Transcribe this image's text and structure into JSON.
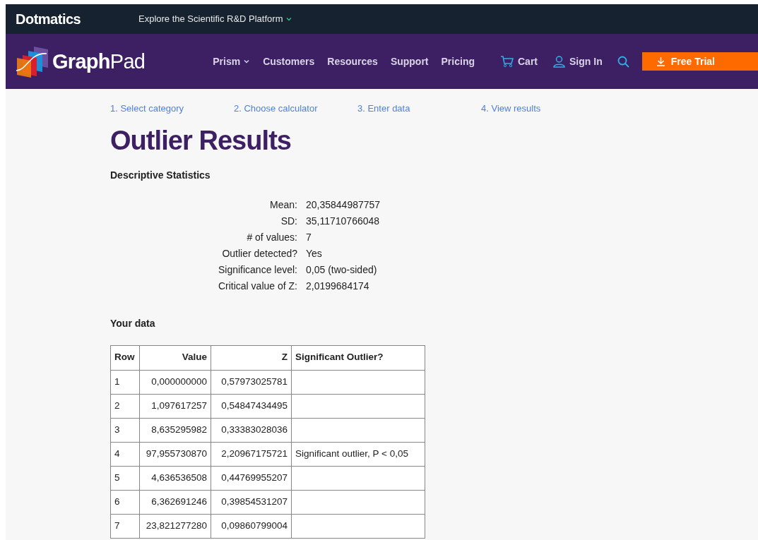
{
  "top_bar": {
    "brand": "Dotmatics",
    "explore": "Explore the Scientific R&D Platform"
  },
  "nav": {
    "logo_bold": "Graph",
    "logo_light": "Pad",
    "items": [
      {
        "label": "Prism",
        "dropdown": true
      },
      {
        "label": "Customers",
        "dropdown": false
      },
      {
        "label": "Resources",
        "dropdown": false
      },
      {
        "label": "Support",
        "dropdown": false
      },
      {
        "label": "Pricing",
        "dropdown": false
      }
    ],
    "cart": "Cart",
    "sign_in": "Sign In",
    "cta": "Free Trial"
  },
  "steps": [
    "1. Select category",
    "2. Choose calculator",
    "3. Enter data",
    "4. View results"
  ],
  "title": "Outlier Results",
  "stats_heading": "Descriptive Statistics",
  "stats": [
    {
      "label": "Mean:",
      "value": "20,35844987757"
    },
    {
      "label": "SD:",
      "value": "35,11710766048"
    },
    {
      "label": "# of values:",
      "value": "7"
    },
    {
      "label": "Outlier detected?",
      "value": "Yes"
    },
    {
      "label": "Significance level:",
      "value": "0,05 (two-sided)"
    },
    {
      "label": "Critical value of Z:",
      "value": "2,0199684174"
    }
  ],
  "data_heading": "Your data",
  "table": {
    "columns": [
      "Row",
      "Value",
      "Z",
      "Significant Outlier?"
    ],
    "rows": [
      [
        "1",
        "0,000000000",
        "0,57973025781",
        ""
      ],
      [
        "2",
        "1,097617257",
        "0,54847434495",
        ""
      ],
      [
        "3",
        "8,635295982",
        "0,33383028036",
        ""
      ],
      [
        "4",
        "97,955730870",
        "2,20967175721",
        "Significant outlier, P < 0,05"
      ],
      [
        "5",
        "4,636536508",
        "0,44769955207",
        ""
      ],
      [
        "6",
        "6,362691246",
        "0,39854531207",
        ""
      ],
      [
        "7",
        "23,821277280",
        "0,09860799004",
        ""
      ]
    ]
  }
}
